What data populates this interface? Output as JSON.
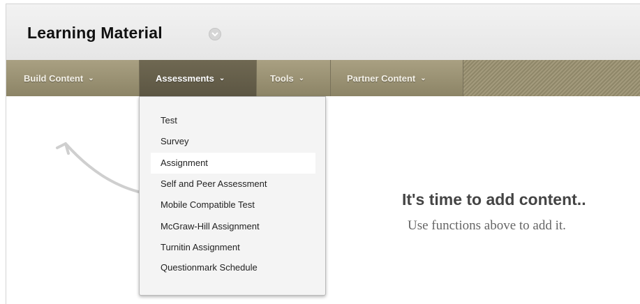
{
  "page": {
    "title": "Learning Material"
  },
  "action_bar": {
    "tabs": [
      {
        "label": "Build Content",
        "caret": "⌄"
      },
      {
        "label": "Assessments",
        "caret": "⌄"
      },
      {
        "label": "Tools",
        "caret": "⌄"
      },
      {
        "label": "Partner Content",
        "caret": "⌄"
      }
    ],
    "active_tab": "Assessments"
  },
  "assessments_menu": {
    "items": [
      {
        "label": "Test"
      },
      {
        "label": "Survey"
      },
      {
        "label": "Assignment"
      },
      {
        "label": "Self and Peer Assessment"
      },
      {
        "label": "Mobile Compatible Test"
      },
      {
        "label": "McGraw-Hill Assignment"
      },
      {
        "label": "Turnitin Assignment"
      },
      {
        "label": "Questionmark Schedule"
      }
    ],
    "hovered_item": "Assignment"
  },
  "empty_state": {
    "heading": "It's time to add content..",
    "subtext": "Use functions above to add it."
  },
  "colors": {
    "action_bar": "#8f8769",
    "active_tab": "#5c5643",
    "menu_bg": "#f4f4f4",
    "menu_hover": "#ffffff"
  }
}
